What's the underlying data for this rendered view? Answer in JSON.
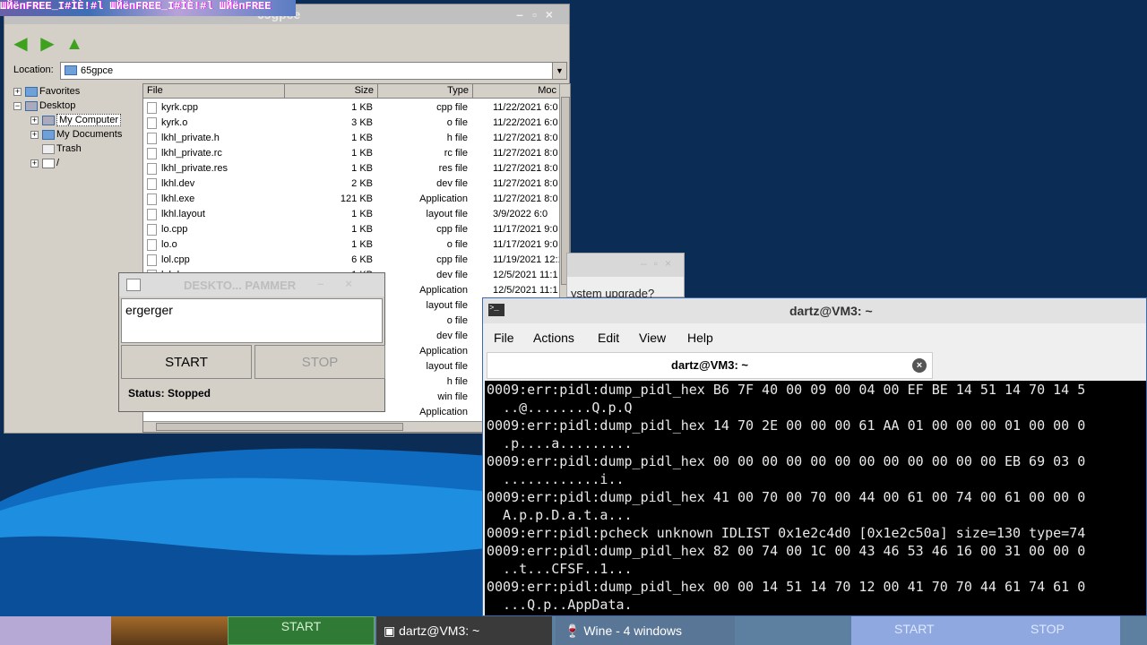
{
  "desktop": {
    "glitch_text": "ШЙёпFREE_I#ÌÈ!#l ШЙёпFREE_I#ÌÈ!#l ШЙёпFREE"
  },
  "explorer": {
    "title": "65gpce",
    "location_label": "Location:",
    "location_value": "65gpce",
    "tree": [
      {
        "label": "Favorites"
      },
      {
        "label": "Desktop"
      },
      {
        "label": "My Computer"
      },
      {
        "label": "My Documents"
      },
      {
        "label": "Trash"
      },
      {
        "label": "/"
      }
    ],
    "columns": {
      "name": "File",
      "size": "Size",
      "type": "Type",
      "modified": "Moc"
    },
    "files": [
      {
        "name": "kyrk.cpp",
        "size": "1 KB",
        "type": "cpp file",
        "modified": "11/22/2021 6:0"
      },
      {
        "name": "kyrk.o",
        "size": "3 KB",
        "type": "o file",
        "modified": "11/22/2021 6:0"
      },
      {
        "name": "lkhl_private.h",
        "size": "1 KB",
        "type": "h file",
        "modified": "11/27/2021 8:0"
      },
      {
        "name": "lkhl_private.rc",
        "size": "1 KB",
        "type": "rc file",
        "modified": "11/27/2021 8:0"
      },
      {
        "name": "lkhl_private.res",
        "size": "1 KB",
        "type": "res file",
        "modified": "11/27/2021 8:0"
      },
      {
        "name": "lkhl.dev",
        "size": "2 KB",
        "type": "dev file",
        "modified": "11/27/2021 8:0"
      },
      {
        "name": "lkhl.exe",
        "size": "121 KB",
        "type": "Application",
        "modified": "11/27/2021 8:0"
      },
      {
        "name": "lkhl.layout",
        "size": "1 KB",
        "type": "layout file",
        "modified": "3/9/2022 6:0"
      },
      {
        "name": "lo.cpp",
        "size": "1 KB",
        "type": "cpp file",
        "modified": "11/17/2021 9:0"
      },
      {
        "name": "lo.o",
        "size": "1 KB",
        "type": "o file",
        "modified": "11/17/2021 9:0"
      },
      {
        "name": "lol.cpp",
        "size": "6 KB",
        "type": "cpp file",
        "modified": "11/19/2021 12:1"
      },
      {
        "name": "lol.dev",
        "size": "1 KB",
        "type": "dev file",
        "modified": "12/5/2021 11:1"
      },
      {
        "name": "",
        "size": "",
        "type": "Application",
        "modified": "12/5/2021 11:1"
      },
      {
        "name": "",
        "size": "",
        "type": "layout file",
        "modified": ""
      },
      {
        "name": "",
        "size": "",
        "type": "o file",
        "modified": ""
      },
      {
        "name": "",
        "size": "",
        "type": "dev file",
        "modified": ""
      },
      {
        "name": "",
        "size": "",
        "type": "Application",
        "modified": ""
      },
      {
        "name": "",
        "size": "",
        "type": "layout file",
        "modified": ""
      },
      {
        "name": "",
        "size": "",
        "type": "h file",
        "modified": ""
      },
      {
        "name": "",
        "size": "",
        "type": "win file",
        "modified": ""
      },
      {
        "name": "",
        "size": "",
        "type": "Application",
        "modified": ""
      }
    ]
  },
  "upgrade_dialog": {
    "message": "ystem upgrade?"
  },
  "spammer": {
    "title": "DESKTO... PAMMER",
    "text": "ergerger",
    "start_label": "START",
    "stop_label": "STOP",
    "status": "Status: Stopped"
  },
  "terminal": {
    "title": "dartz@VM3: ~",
    "menu": [
      "File",
      "Actions",
      "Edit",
      "View",
      "Help"
    ],
    "tab_label": "dartz@VM3: ~",
    "lines": [
      "0009:err:pidl:dump_pidl_hex B6 7F 40 00 09 00 04 00 EF BE 14 51 14 70 14 5",
      "  ..@........Q.p.Q",
      "0009:err:pidl:dump_pidl_hex 14 70 2E 00 00 00 61 AA 01 00 00 00 01 00 00 0",
      "  .p....a.........",
      "0009:err:pidl:dump_pidl_hex 00 00 00 00 00 00 00 00 00 00 00 00 EB 69 03 0",
      "  ............i..",
      "0009:err:pidl:dump_pidl_hex 41 00 70 00 70 00 44 00 61 00 74 00 61 00 00 0",
      "  A.p.p.D.a.t.a...",
      "0009:err:pidl:pcheck unknown IDLIST 0x1e2c4d0 [0x1e2c50a] size=130 type=74",
      "0009:err:pidl:dump_pidl_hex 82 00 74 00 1C 00 43 46 53 46 16 00 31 00 00 0",
      "  ..t...CFSF..1...",
      "0009:err:pidl:dump_pidl_hex 00 00 14 51 14 70 12 00 41 70 70 44 61 74 61 0",
      "  ...Q.p..AppData."
    ]
  },
  "taskbar": {
    "start_label": "START",
    "task1_label": "dartz@VM3: ~",
    "task2_label": "Wine - 4 windows",
    "glitch_start": "START",
    "glitch_stop": "STOP"
  },
  "colors": {
    "desktop_bg": "#0b2d55",
    "wave": "#1e8fe0",
    "terminal_bg": "#000000"
  }
}
